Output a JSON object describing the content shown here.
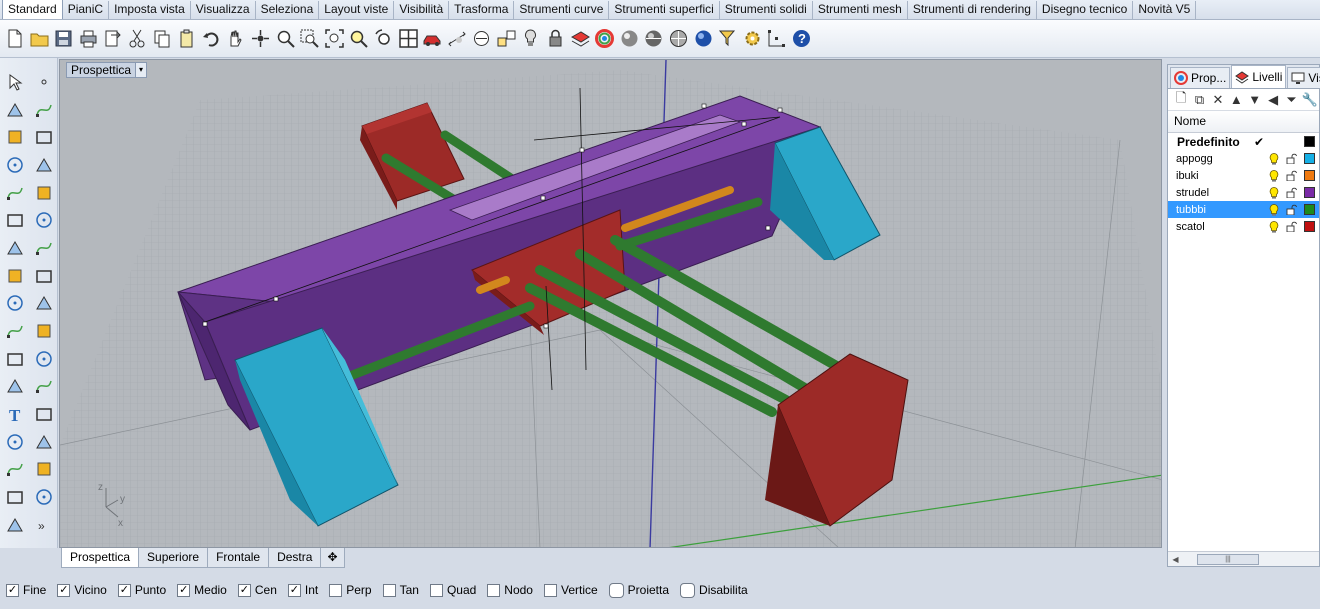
{
  "menu_tabs": [
    "Standard",
    "PianiC",
    "Imposta vista",
    "Visualizza",
    "Seleziona",
    "Layout viste",
    "Visibilità",
    "Trasforma",
    "Strumenti curve",
    "Strumenti superfici",
    "Strumenti solidi",
    "Strumenti mesh",
    "Strumenti di rendering",
    "Disegno tecnico",
    "Novità V5"
  ],
  "active_menu_tab": "Standard",
  "toolbar_icons": [
    "new-file-icon",
    "open-folder-icon",
    "save-icon",
    "print-icon",
    "import-icon",
    "cut-icon",
    "copy-icon",
    "paste-icon",
    "undo-icon",
    "pan-hand-icon",
    "rotate-view-icon",
    "zoom-icon",
    "zoom-window-icon",
    "zoom-extents-icon",
    "zoom-selected-icon",
    "undo-view-icon",
    "four-viewports-icon",
    "car-icon",
    "dimension-icon",
    "cplane-icon",
    "snap-point-icon",
    "light-bulb-icon",
    "lock-icon",
    "layer-icon",
    "color-wheel-icon",
    "shaded-sphere-icon",
    "rendered-sphere-icon",
    "ghosted-sphere-icon",
    "blue-sphere-icon",
    "select-filter-icon",
    "gear-icon",
    "grid-snap-icon",
    "help-icon"
  ],
  "viewport": {
    "title": "Prospettica",
    "menu_arrow": "▾",
    "axis_labels": {
      "z": "z",
      "y": "y",
      "x": "x"
    }
  },
  "viewport_tabs": [
    "Prospettica",
    "Superiore",
    "Frontale",
    "Destra"
  ],
  "active_viewport_tab": "Prospettica",
  "add_tab_label": "✥",
  "osnaps": [
    {
      "label": "Fine",
      "checked": true
    },
    {
      "label": "Vicino",
      "checked": true
    },
    {
      "label": "Punto",
      "checked": true
    },
    {
      "label": "Medio",
      "checked": true
    },
    {
      "label": "Cen",
      "checked": true
    },
    {
      "label": "Int",
      "checked": true
    },
    {
      "label": "Perp",
      "checked": false
    },
    {
      "label": "Tan",
      "checked": false
    },
    {
      "label": "Quad",
      "checked": false
    },
    {
      "label": "Nodo",
      "checked": false
    },
    {
      "label": "Vertice",
      "checked": false
    },
    {
      "label": "Proietta",
      "checked": false,
      "round": true
    },
    {
      "label": "Disabilita",
      "checked": false,
      "round": true
    }
  ],
  "panel": {
    "tabs": [
      {
        "label": "Prop...",
        "icon": "properties-icon"
      },
      {
        "label": "Livelli",
        "icon": "layers-icon",
        "active": true
      },
      {
        "label": "Vis",
        "icon": "display-icon"
      }
    ],
    "header": "Nome",
    "layers": [
      {
        "name": "Predefinito",
        "current": true,
        "check": "✔",
        "color": "#000000"
      },
      {
        "name": "appogg",
        "color": "#16b0e6"
      },
      {
        "name": "ibuki",
        "color": "#f07a10"
      },
      {
        "name": "strudel",
        "color": "#7a2aa6"
      },
      {
        "name": "tubbbi",
        "color": "#1c8a1c",
        "selected": true
      },
      {
        "name": "scatol",
        "color": "#c01010"
      }
    ],
    "scroll_thumb": "|||"
  },
  "colors": {
    "frame_purple": "#6a3a8e",
    "cyan_support": "#2aa7c9",
    "red_box": "#a32c2a",
    "green_rod": "#2f7a2f",
    "orange_rod": "#d2871d",
    "viewport_bg": "#b4b8bd",
    "accent_blue": "#3399ff"
  }
}
